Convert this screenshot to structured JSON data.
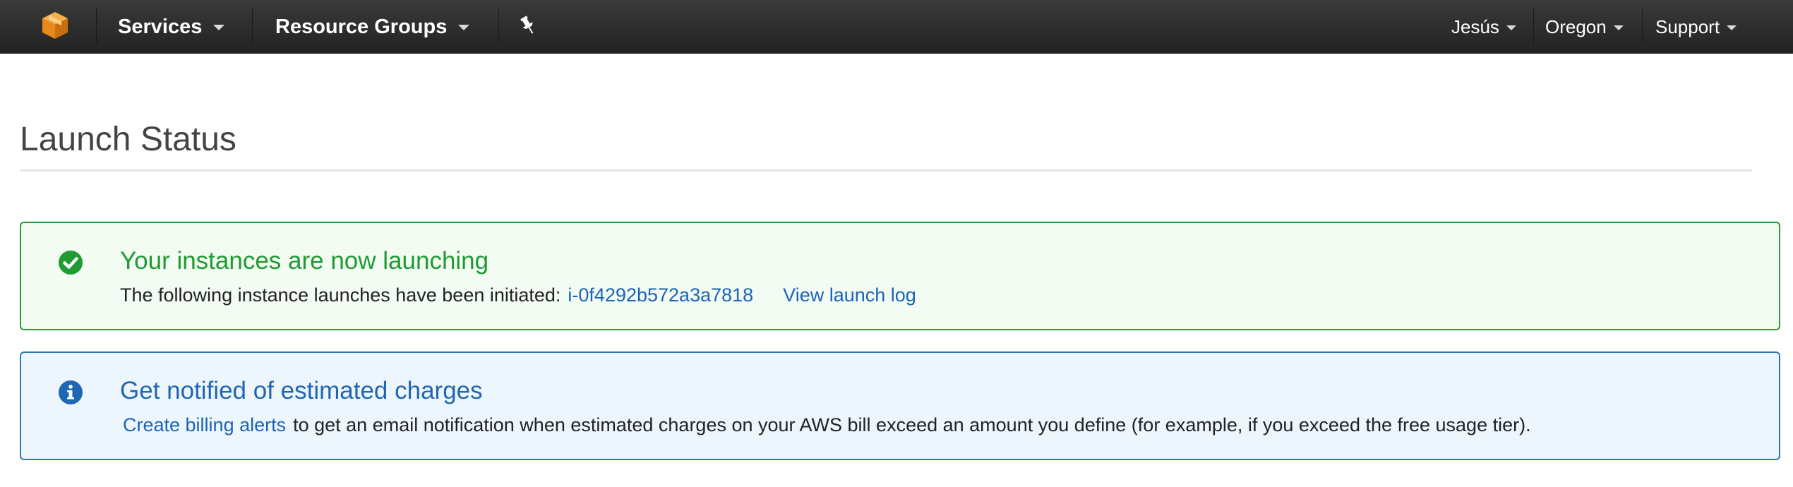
{
  "nav": {
    "services_label": "Services",
    "resource_groups_label": "Resource Groups",
    "user_label": "Jesús",
    "region_label": "Oregon",
    "support_label": "Support",
    "icons": {
      "logo": "aws-cube-logo",
      "pin": "pushpin-icon"
    }
  },
  "page": {
    "title": "Launch Status"
  },
  "success_alert": {
    "title": "Your instances are now launching",
    "body_text": "The following instance launches have been initiated:",
    "instance_id": "i-0f4292b572a3a7818",
    "view_log_label": "View launch log",
    "icon": "check-circle-icon",
    "color": "#1f9b31"
  },
  "info_alert": {
    "title": "Get notified of estimated charges",
    "link_text": "Create billing alerts",
    "body_text": "to get an email notification when estimated charges on your AWS bill exceed an amount you define (for example, if you exceed the free usage tier).",
    "icon": "info-circle-icon",
    "color": "#1f66b3"
  },
  "colors": {
    "nav_background": "#2b2b2b",
    "logo_orange": "#f4921f",
    "link_blue": "#1a63b9",
    "success_border": "#2e9b3b",
    "success_background": "#f3fcf3",
    "info_border": "#2f76b4",
    "info_background": "#eef6fd"
  }
}
